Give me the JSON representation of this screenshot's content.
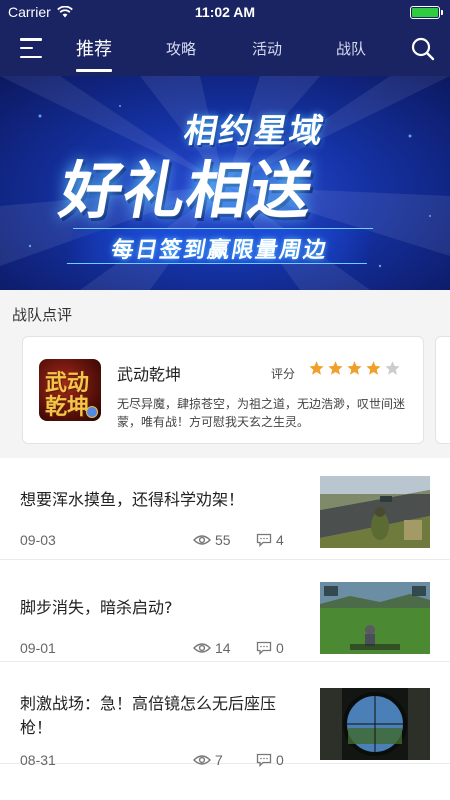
{
  "status_bar": {
    "carrier": "Carrier",
    "time": "11:02 AM",
    "icons": [
      "wifi-icon",
      "battery-icon"
    ]
  },
  "nav": {
    "tabs": [
      {
        "label": "推荐",
        "active": true
      },
      {
        "label": "攻略",
        "active": false
      },
      {
        "label": "活动",
        "active": false
      },
      {
        "label": "战队",
        "active": false
      }
    ],
    "icons": [
      "menu-icon",
      "search-icon"
    ]
  },
  "banner": {
    "line1": "相约星域",
    "line2": "好礼相送",
    "line3": "每日签到赢限量周边"
  },
  "team_review": {
    "title": "战队点评",
    "card": {
      "icon_text_1": "武动",
      "icon_text_2": "乾坤",
      "name": "武动乾坤",
      "rating_label": "评分",
      "rating": 4,
      "rating_max": 5,
      "description": "无尽异魔，肆掠苍空，为祖之道，无边浩渺，叹世间迷蒙，唯有战！方可慰我天玄之生灵。"
    }
  },
  "news": [
    {
      "title": "想要浑水摸鱼，还得科学劝架！",
      "date": "09-03",
      "views": "55",
      "comments": "4"
    },
    {
      "title": "脚步消失，暗杀启动?",
      "date": "09-01",
      "views": "14",
      "comments": "0"
    },
    {
      "title": "刺激战场：急！高倍镜怎么无后座压枪！",
      "date": "08-31",
      "views": "7",
      "comments": "0"
    }
  ],
  "colors": {
    "nav_bg": "#1a2463",
    "star_on": "#f0a02a",
    "star_off": "#cccccc"
  }
}
